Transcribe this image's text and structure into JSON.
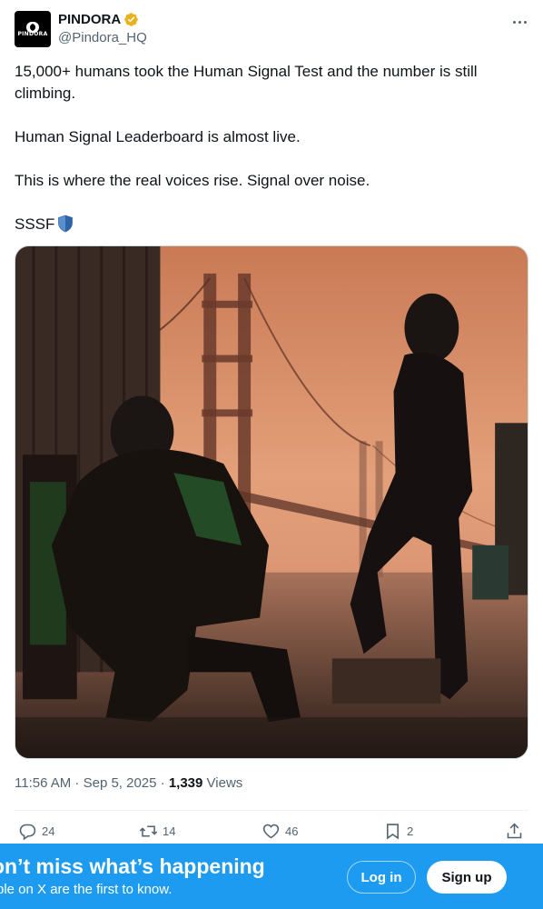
{
  "tweet": {
    "author": {
      "name": "PINDORA",
      "handle": "@Pindora_HQ",
      "avatar_text": "PINDORA",
      "verified_color": "#e8b21c"
    },
    "paragraphs": [
      "15,000+ humans took the Human Signal Test and the number is still climbing.",
      "Human Signal Leaderboard is almost live.",
      "This is where the real voices rise. Signal over noise.",
      "SSSF"
    ],
    "shield_emoji_icon": "shield-emoji-icon",
    "timestamp": "11:56 AM · Sep 5, 2025 · ",
    "views_count": "1,339",
    "views_label": " Views"
  },
  "actions": {
    "replies": "24",
    "reposts": "14",
    "likes": "46",
    "bookmarks": "2"
  },
  "banner": {
    "title": "on’t miss what’s happening",
    "subtitle": "ple on X are the first to know.",
    "login_label": "Log in",
    "signup_label": "Sign up",
    "color": "#1d9bf0"
  }
}
